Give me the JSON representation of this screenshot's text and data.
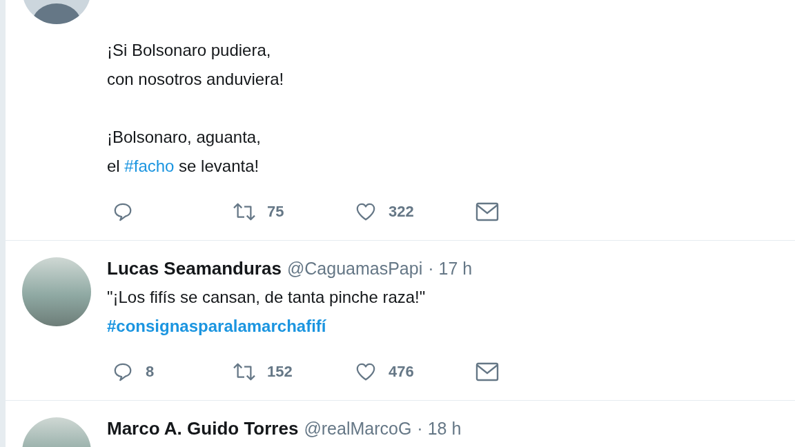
{
  "tweets": [
    {
      "paragraphs": [
        {
          "lines": [
            [
              {
                "kind": "text",
                "text": "¡Si Bolsonaro pudiera,"
              }
            ],
            [
              {
                "kind": "text",
                "text": "con nosotros anduviera!"
              }
            ]
          ]
        },
        {
          "lines": [
            [
              {
                "kind": "text",
                "text": "¡Bolsonaro, aguanta,"
              }
            ],
            [
              {
                "kind": "text",
                "text": "el "
              },
              {
                "kind": "hashtag",
                "text": "#facho"
              },
              {
                "kind": "text",
                "text": " se levanta!"
              }
            ]
          ]
        }
      ],
      "actions": [
        {
          "kind": "reply"
        },
        {
          "kind": "retweet",
          "count": "75"
        },
        {
          "kind": "like",
          "count": "322"
        },
        {
          "kind": "message"
        }
      ]
    },
    {
      "name": "Lucas Seamanduras",
      "handle": "@CaguamasPapi",
      "time": "· 17 h",
      "paragraphs": [
        {
          "lines": [
            [
              {
                "kind": "text",
                "text": "\"¡Los fifís se cansan, de tanta pinche raza!\""
              }
            ],
            [
              {
                "kind": "hashtag_bold",
                "text": "#consignasparalamarchafifí"
              }
            ]
          ]
        }
      ],
      "actions": [
        {
          "kind": "reply",
          "count": "8"
        },
        {
          "kind": "retweet",
          "count": "152"
        },
        {
          "kind": "like",
          "count": "476"
        },
        {
          "kind": "message"
        }
      ]
    },
    {
      "name": "Marco A. Guido Torres",
      "handle": "@realMarcoG",
      "time": "· 18 h"
    }
  ]
}
